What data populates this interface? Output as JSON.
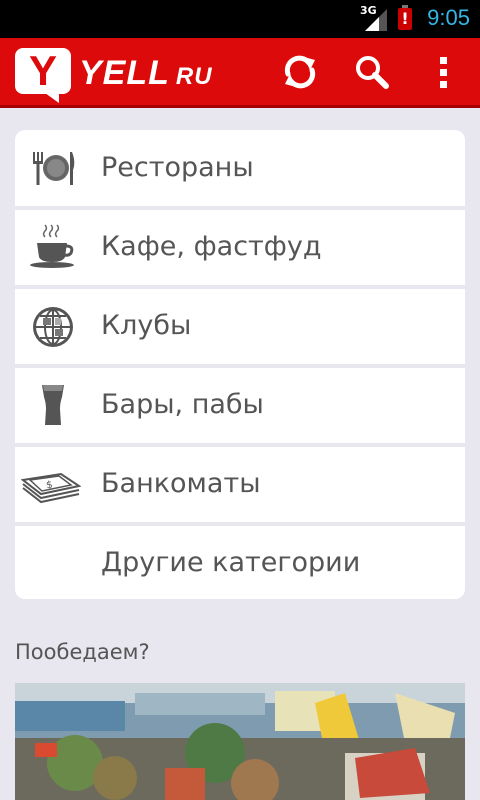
{
  "status_bar": {
    "network": "3G",
    "battery_alert": "!",
    "time": "9:05"
  },
  "action_bar": {
    "logo_letter": "Y",
    "logo_name": "YELL",
    "logo_domain": "RU",
    "actions": [
      "refresh-icon",
      "search-icon",
      "overflow-menu-icon"
    ]
  },
  "categories": [
    {
      "label": "Рестораны",
      "icon": "plate-cutlery-icon"
    },
    {
      "label": "Кафе, фастфуд",
      "icon": "coffee-cup-icon"
    },
    {
      "label": "Клубы",
      "icon": "disco-ball-icon"
    },
    {
      "label": "Бары, пабы",
      "icon": "beer-glass-icon"
    },
    {
      "label": "Банкоматы",
      "icon": "cash-banknotes-icon"
    },
    {
      "label": "Другие категории",
      "icon": ""
    }
  ],
  "section": {
    "title": "Пообедаем?"
  },
  "colors": {
    "brand_red": "#dc0a0a",
    "background": "#e8e6ee",
    "status_time": "#33b5e5"
  }
}
